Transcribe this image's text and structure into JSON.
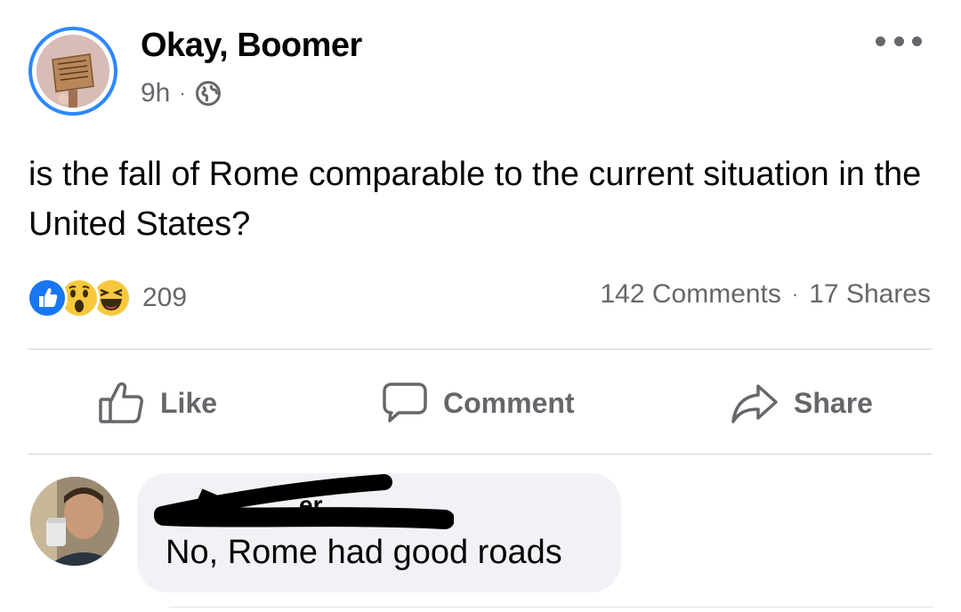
{
  "post": {
    "page_name": "Okay, Boomer",
    "time": "9h",
    "separator": "·",
    "privacy_icon": "globe-icon",
    "more_icon": "more-options-icon",
    "text": "is the fall of Rome comparable to the current situation in the United States?"
  },
  "engagement": {
    "reactions": [
      "like",
      "wow",
      "haha"
    ],
    "reaction_count": "209",
    "comments": "142 Comments",
    "separator": "·",
    "shares": "17 Shares"
  },
  "actions": {
    "like_label": "Like",
    "comment_label": "Comment",
    "share_label": "Share"
  },
  "comment": {
    "author_visible": "er",
    "text": "No, Rome had good roads"
  },
  "colors": {
    "accent": "#2d88ff",
    "secondary_text": "#65676b",
    "bubble": "#f0f2f5",
    "divider": "#ced0d4"
  }
}
